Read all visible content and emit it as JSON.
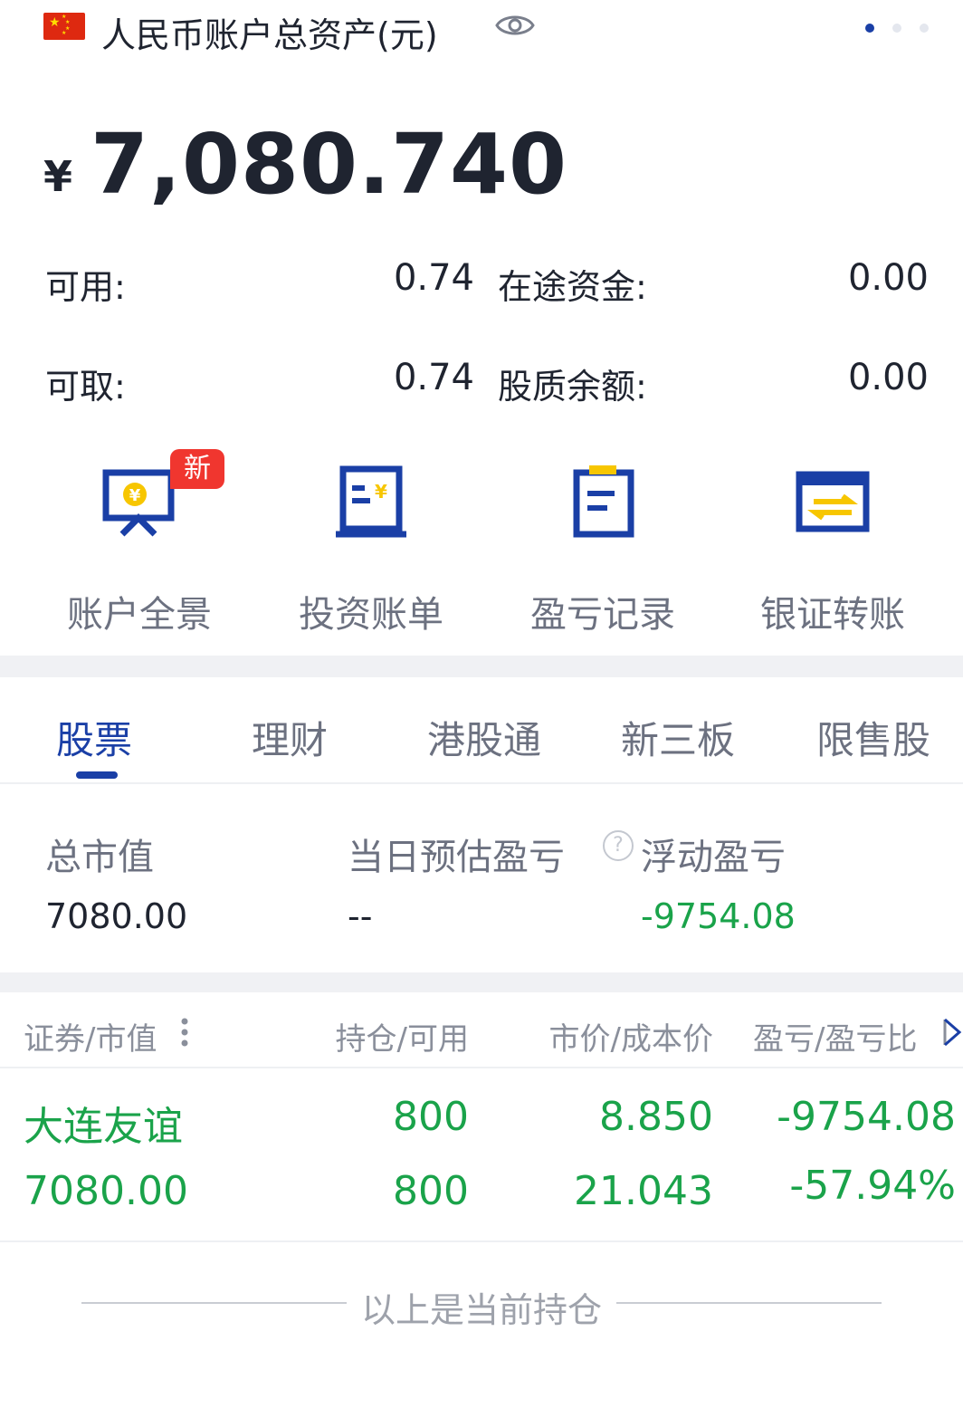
{
  "header": {
    "title": "人民币账户总资产(元)",
    "icons": {
      "flag": "china-flag-icon",
      "eye": "eye-icon"
    },
    "page_dots": {
      "count": 3,
      "active_index": 0
    }
  },
  "balance": {
    "currency_symbol": "¥",
    "total": "7,080.740"
  },
  "info": {
    "available_label": "可用:",
    "available_value": "0.74",
    "in_transit_label": "在途资金:",
    "in_transit_value": "0.00",
    "withdrawable_label": "可取:",
    "withdrawable_value": "0.74",
    "pledge_label": "股质余额:",
    "pledge_value": "0.00"
  },
  "quick_actions": [
    {
      "label": "账户全景",
      "icon": "account-overview-icon",
      "badge": "新"
    },
    {
      "label": "投资账单",
      "icon": "investment-bill-icon"
    },
    {
      "label": "盈亏记录",
      "icon": "profit-loss-record-icon"
    },
    {
      "label": "银证转账",
      "icon": "bank-transfer-icon"
    }
  ],
  "tabs": [
    {
      "label": "股票",
      "active": true
    },
    {
      "label": "理财"
    },
    {
      "label": "港股通"
    },
    {
      "label": "新三板"
    },
    {
      "label": "限售股"
    }
  ],
  "summary": {
    "market_value_label": "总市值",
    "market_value": "7080.00",
    "daily_pl_label": "当日预估盈亏",
    "daily_pl": "--",
    "floating_pl_label": "浮动盈亏",
    "floating_pl": "-9754.08",
    "help_icon": "question-circle-icon"
  },
  "table": {
    "headers": [
      "证券/市值",
      "持仓/可用",
      "市价/成本价",
      "盈亏/盈亏比"
    ],
    "rows": [
      {
        "name": "大连友谊",
        "market_value": "7080.00",
        "position": "800",
        "available": "800",
        "price": "8.850",
        "cost": "21.043",
        "pl": "-9754.08",
        "pl_ratio": "-57.94%"
      }
    ]
  },
  "footer": {
    "text": "以上是当前持仓"
  },
  "colors": {
    "accent": "#1a3fa6",
    "loss_green": "#1aa34a",
    "badge_red": "#f0362f",
    "icon_yellow": "#f7c600"
  }
}
